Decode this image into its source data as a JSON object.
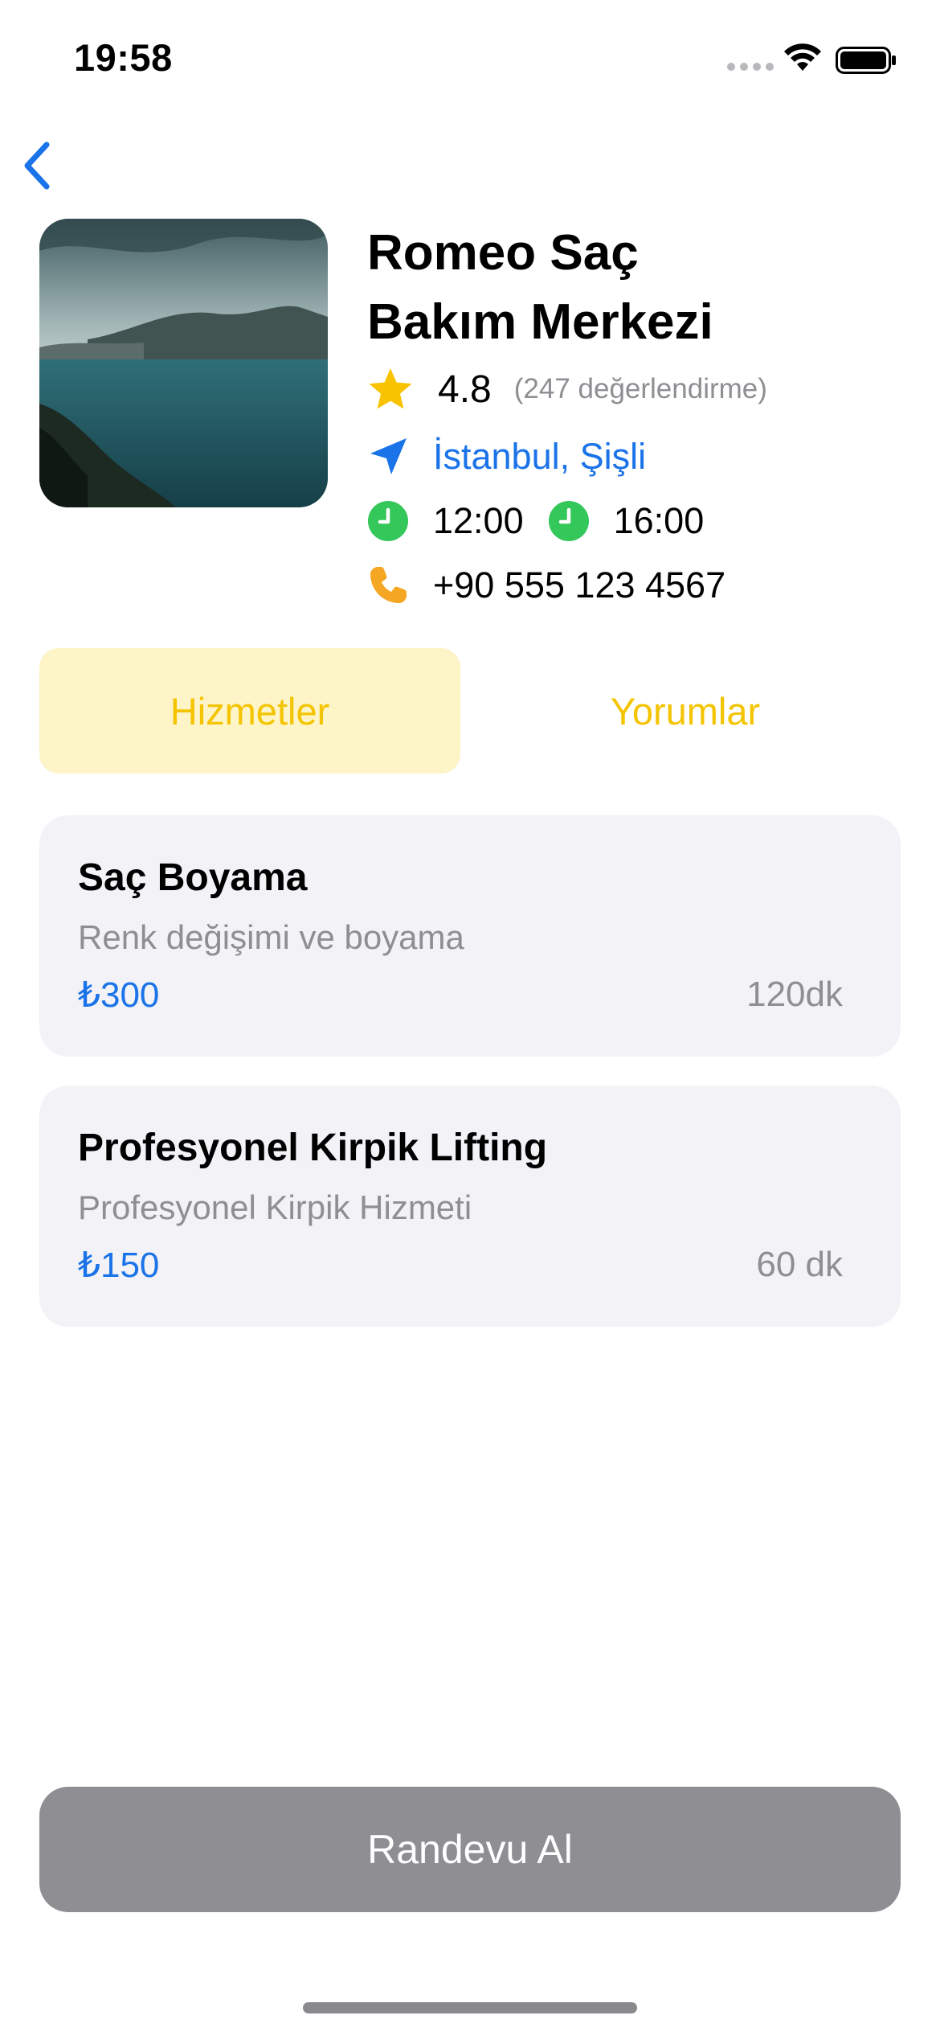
{
  "status_bar": {
    "time": "19:58"
  },
  "business": {
    "name_line1": "Romeo Saç",
    "name_line2": "Bakım Merkezi",
    "rating": "4.8",
    "rating_count": "(247 değerlendirme)",
    "location": "İstanbul, Şişli",
    "open_time": "12:00",
    "close_time": "16:00",
    "phone": "+90 555 123 4567"
  },
  "tabs": [
    {
      "label": "Hizmetler",
      "active": true
    },
    {
      "label": "Yorumlar",
      "active": false
    }
  ],
  "services": [
    {
      "title": "Saç Boyama",
      "description": "Renk değişimi ve boyama",
      "price": "₺300",
      "duration": "120dk"
    },
    {
      "title": "Profesyonel Kirpik Lifting",
      "description": "Profesyonel Kirpik Hizmeti",
      "price": "₺150",
      "duration": "60 dk"
    }
  ],
  "actions": {
    "appointment_label": "Randevu Al"
  },
  "icons": {
    "back": "chevron-left-icon",
    "rating": "star-icon",
    "location": "location-arrow-icon",
    "open": "clock-icon",
    "close": "clock-icon",
    "phone": "phone-icon"
  },
  "colors": {
    "accent_blue": "#1a73e8",
    "tab_yellow": "#f5c400",
    "tab_active_bg": "#fdf4c8",
    "star": "#f8c300",
    "clock_green": "#34c759",
    "phone_orange": "#f5a623",
    "card_bg": "#f2f2f7",
    "button_gray": "#8e8e93"
  }
}
